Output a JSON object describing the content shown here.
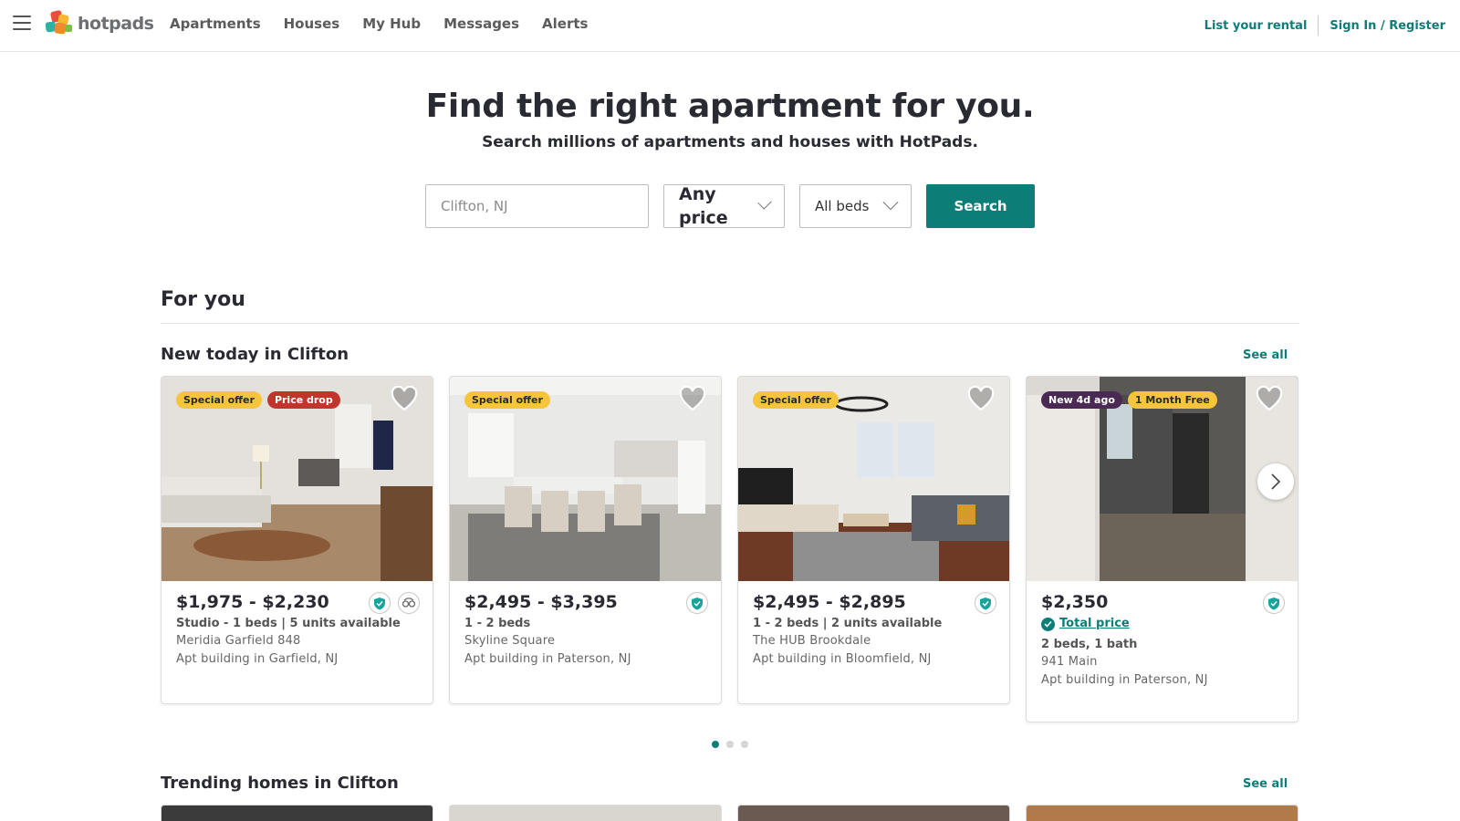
{
  "header": {
    "logo_text": "hotpads",
    "nav": [
      "Apartments",
      "Houses",
      "My Hub",
      "Messages",
      "Alerts"
    ],
    "list_rental": "List your rental",
    "sign_in": "Sign In / Register"
  },
  "hero": {
    "title": "Find the right apartment for you.",
    "subtitle": "Search millions of apartments and houses with HotPads.",
    "location_placeholder": "Clifton, NJ",
    "price_label": "Any price",
    "beds_label": "All beds",
    "search_label": "Search"
  },
  "for_you": {
    "title": "For you"
  },
  "new_today": {
    "title": "New today in Clifton",
    "see_all": "See all",
    "cards": [
      {
        "badges": [
          "Special offer",
          "Price drop"
        ],
        "price": "$1,975 - $2,230",
        "beds": "Studio - 1 beds | 5 units available",
        "name": "Meridia Garfield 848",
        "location": "Apt building in Garfield, NJ"
      },
      {
        "badges": [
          "Special offer"
        ],
        "price": "$2,495 - $3,395",
        "beds": "1 - 2 beds",
        "name": "Skyline Square",
        "location": "Apt building in Paterson, NJ"
      },
      {
        "badges": [
          "Special offer"
        ],
        "price": "$2,495 - $2,895",
        "beds": "1 - 2 beds | 2 units available",
        "name": "The HUB Brookdale",
        "location": "Apt building in Bloomfield, NJ"
      },
      {
        "badges": [
          "New 4d ago",
          "1 Month Free"
        ],
        "price": "$2,350",
        "total_price": "Total price",
        "beds": "2 beds, 1 bath",
        "name": "941 Main",
        "location": "Apt building in Paterson, NJ"
      }
    ]
  },
  "trending": {
    "title": "Trending homes in Clifton",
    "see_all": "See all"
  },
  "colors": {
    "accent": "#0d7d78",
    "badge_yellow": "#f7c53c",
    "badge_red": "#c1352c",
    "badge_purple": "#4a2a55"
  }
}
